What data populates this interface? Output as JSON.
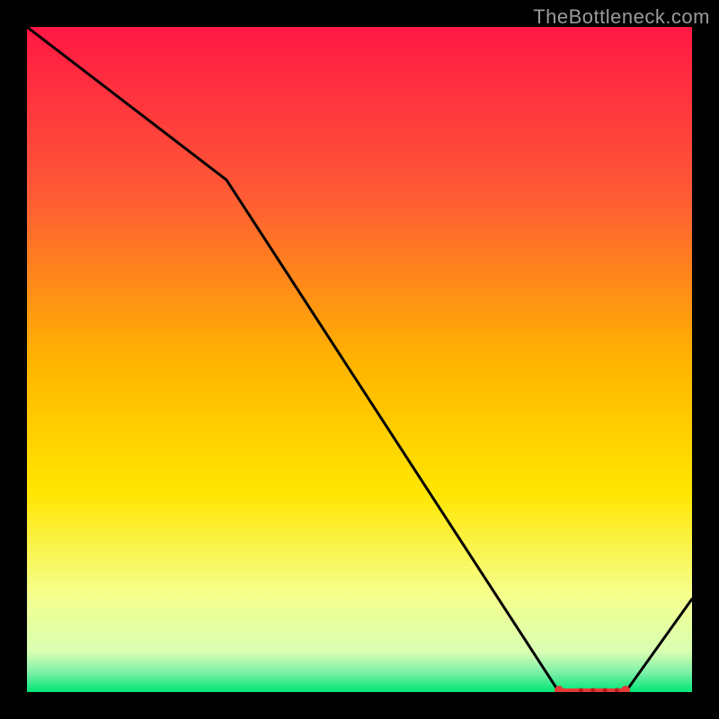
{
  "watermark": "TheBottleneck.com",
  "chart_data": {
    "type": "line",
    "title": "",
    "xlabel": "",
    "ylabel": "",
    "xlim": [
      0,
      100
    ],
    "ylim": [
      0,
      100
    ],
    "x": [
      0,
      30,
      80,
      90,
      100
    ],
    "values": [
      100,
      77,
      0,
      0,
      14
    ],
    "optimal_band": {
      "x_start": 80,
      "x_end": 90,
      "y": 0
    },
    "background_gradient": {
      "stops": [
        {
          "offset": 0.0,
          "color": "#ff1744"
        },
        {
          "offset": 0.25,
          "color": "#ff5a36"
        },
        {
          "offset": 0.5,
          "color": "#ffb300"
        },
        {
          "offset": 0.7,
          "color": "#ffe600"
        },
        {
          "offset": 0.85,
          "color": "#f6ff8a"
        },
        {
          "offset": 0.94,
          "color": "#d8ffb3"
        },
        {
          "offset": 0.97,
          "color": "#7ff0a8"
        },
        {
          "offset": 1.0,
          "color": "#00e676"
        }
      ]
    }
  }
}
